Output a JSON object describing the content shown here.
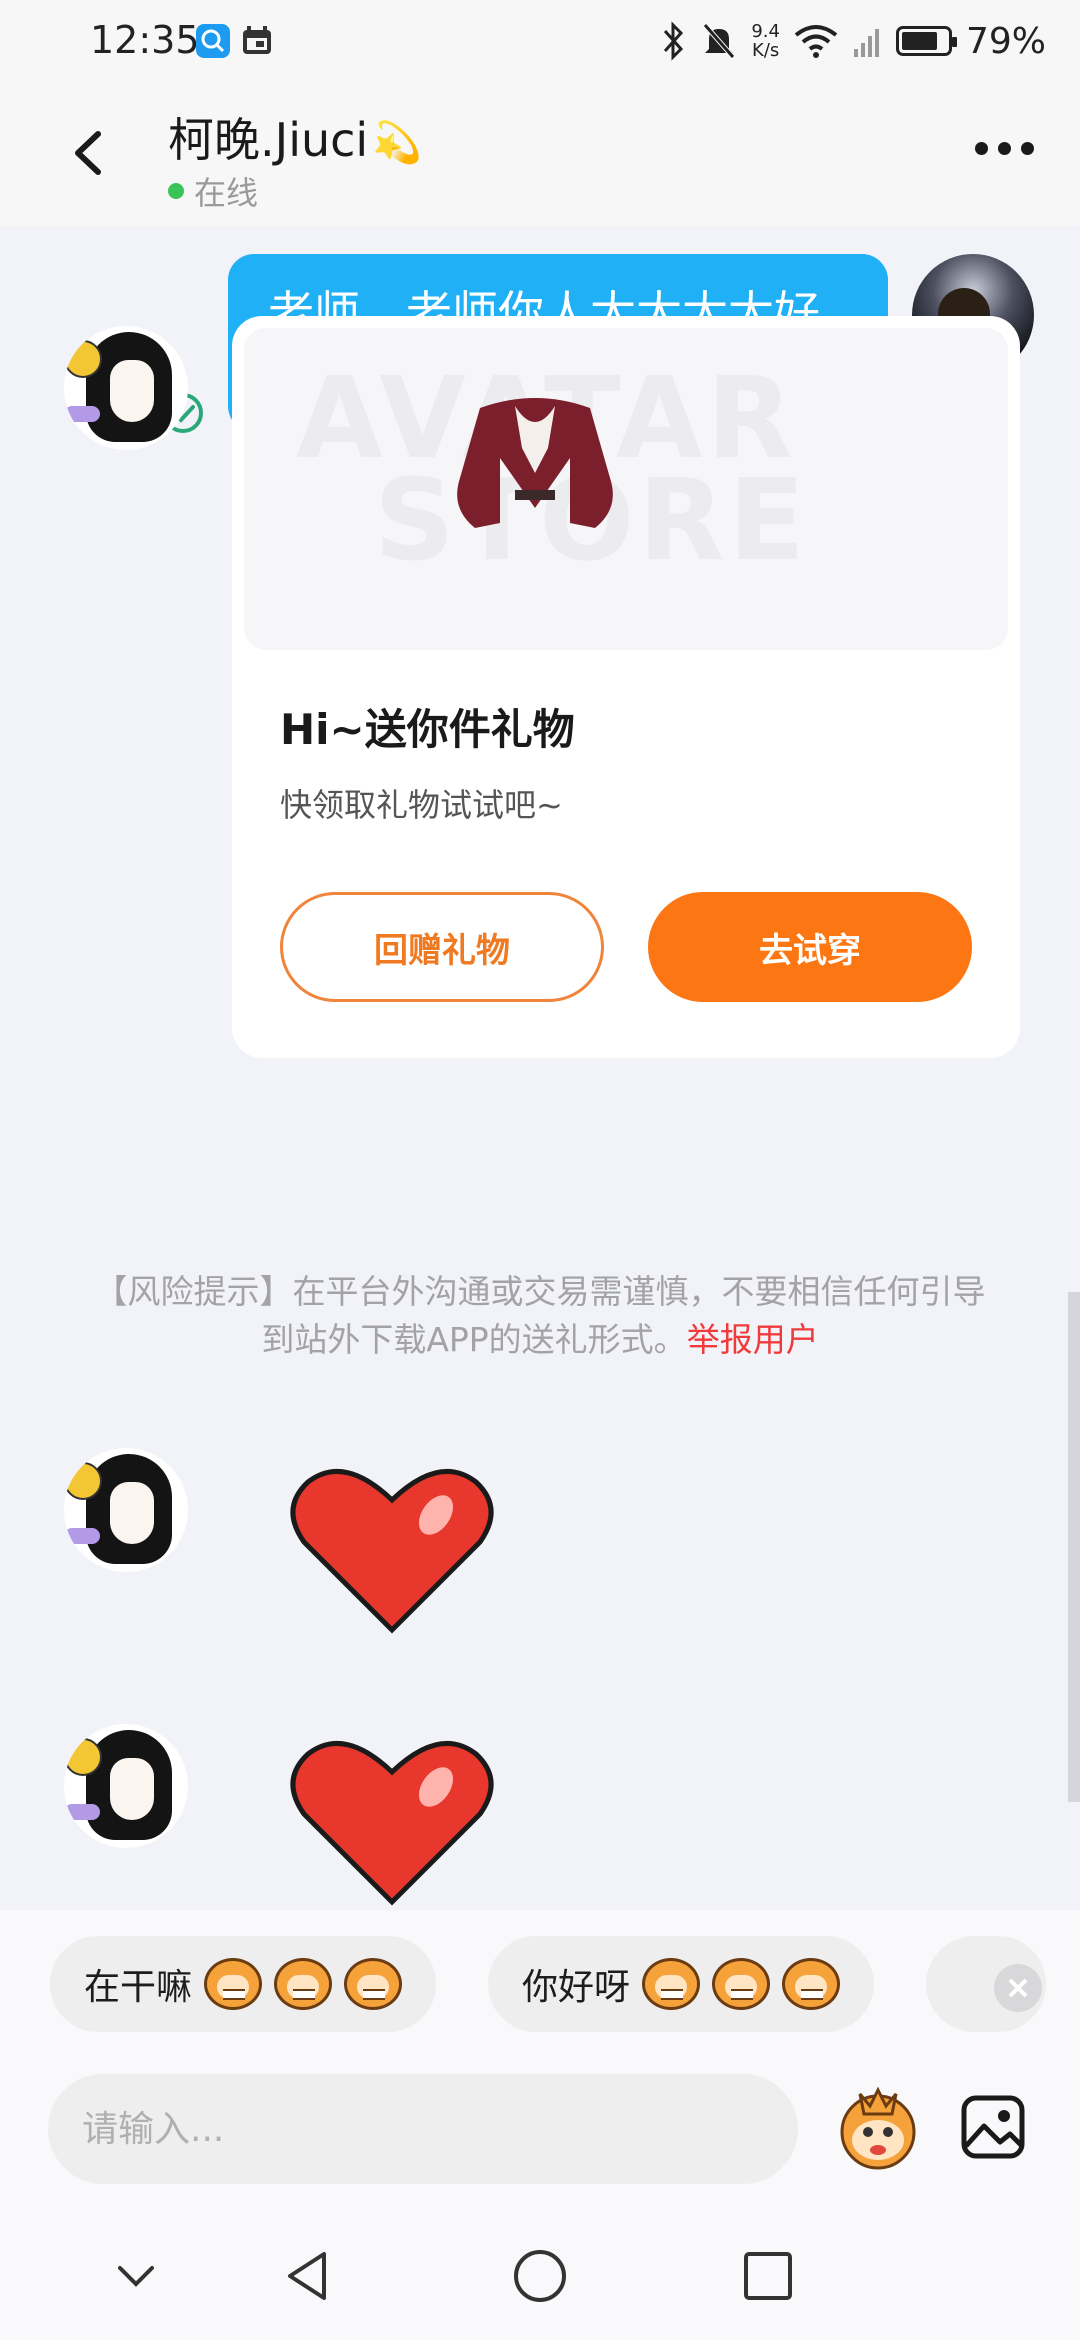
{
  "status_bar": {
    "time": "12:35",
    "net_speed_value": "9.4",
    "net_speed_unit": "K/s",
    "battery_percent": "79%",
    "battery_level": 0.79
  },
  "header": {
    "contact_name": "柯晚.Jiuci",
    "contact_name_emoji": "💫",
    "status_text": "在线"
  },
  "messages": {
    "outgoing_text": "老师，老师你人太太太太好了！！！",
    "gift_card": {
      "title": "Hi~送你件礼物",
      "description": "快领取礼物试试吧~",
      "image_watermark_line1": "AVATAR",
      "image_watermark_line2": "STORE",
      "return_gift_label": "回赠礼物",
      "try_on_label": "去试穿"
    },
    "risk_notice": {
      "text": "【风险提示】在平台外沟通或交易需谨慎，不要相信任何引导到站外下载APP的送礼形式。",
      "report_link": "举报用户"
    }
  },
  "quick_replies": [
    {
      "label": "在干嘛"
    },
    {
      "label": "你好呀"
    }
  ],
  "input": {
    "placeholder": "请输入..."
  },
  "colors": {
    "bubble_blue": "#1fb0f5",
    "accent_orange": "#fc7713",
    "online_green": "#39c45a",
    "report_red": "#ef3b3b"
  }
}
